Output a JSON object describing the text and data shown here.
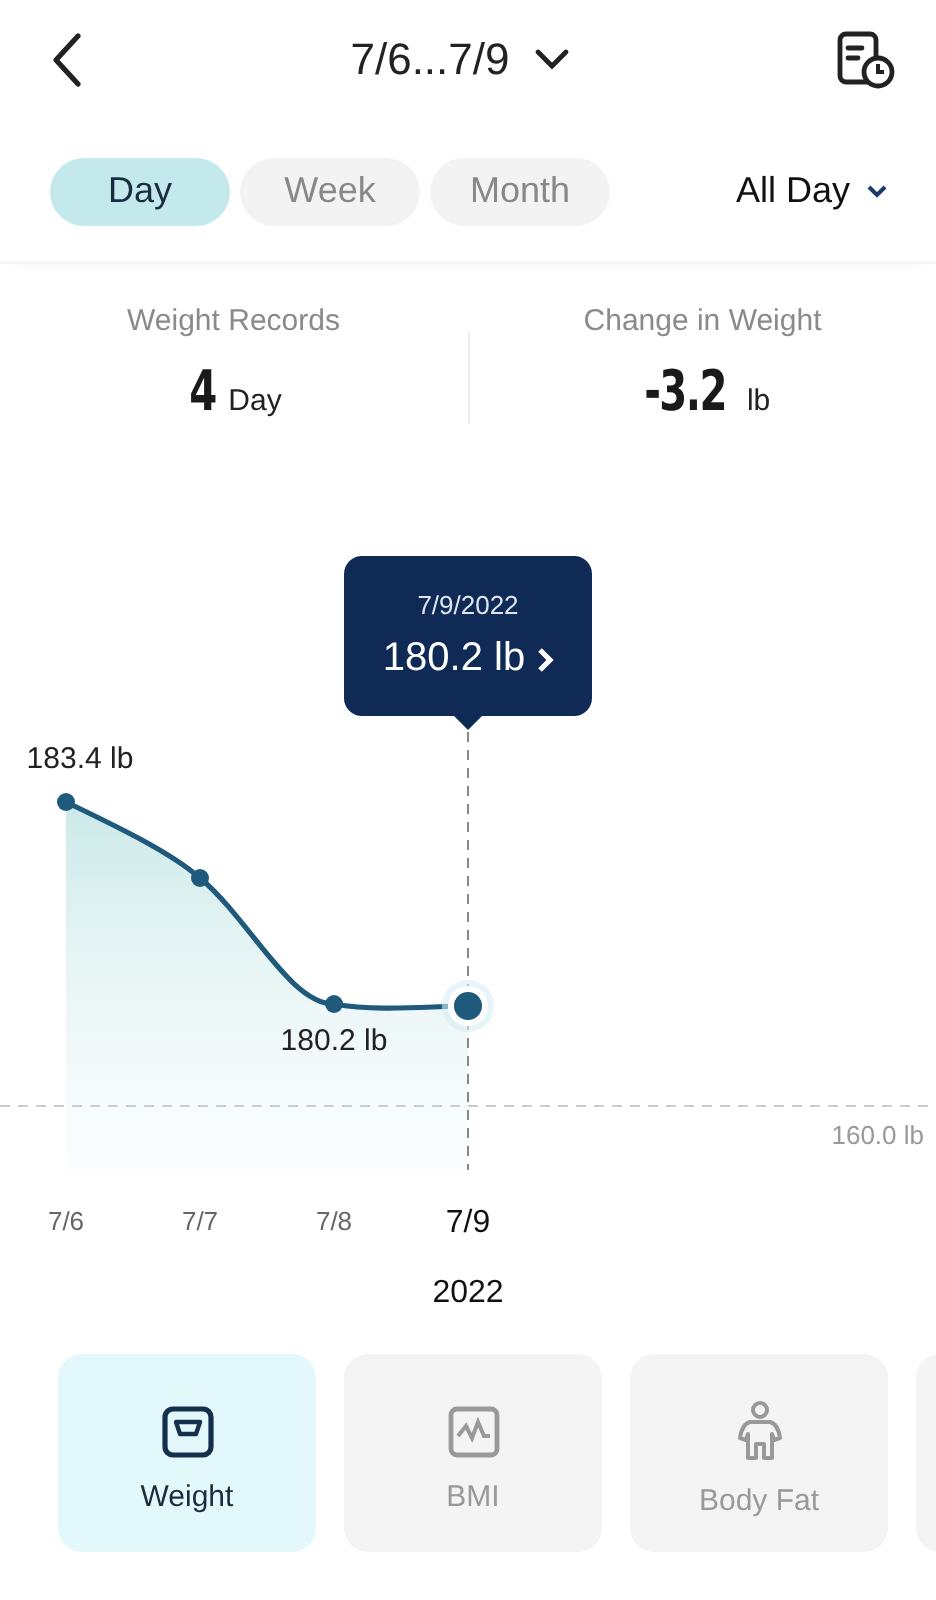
{
  "header": {
    "date_range": "7/6...7/9"
  },
  "period_tabs": [
    {
      "label": "Day",
      "selected": true
    },
    {
      "label": "Week",
      "selected": false
    },
    {
      "label": "Month",
      "selected": false
    }
  ],
  "time_filter": {
    "label": "All Day"
  },
  "stats": [
    {
      "label": "Weight Records",
      "value": "4",
      "unit": "Day"
    },
    {
      "label": "Change in Weight",
      "value": "-3.2",
      "unit": "lb"
    }
  ],
  "chart": {
    "tooltip": {
      "date": "7/9/2022",
      "value": "180.2 lb"
    },
    "point_labels": [
      "183.4 lb",
      "180.2 lb"
    ],
    "reference_label": "160.0 lb",
    "x_labels": [
      {
        "label": "7/6",
        "selected": false
      },
      {
        "label": "7/7",
        "selected": false
      },
      {
        "label": "7/8",
        "selected": false
      },
      {
        "label": "7/9",
        "selected": true
      }
    ],
    "year": "2022"
  },
  "metrics": [
    {
      "label": "Weight",
      "selected": true
    },
    {
      "label": "BMI",
      "selected": false
    },
    {
      "label": "Body Fat",
      "selected": false
    }
  ]
}
